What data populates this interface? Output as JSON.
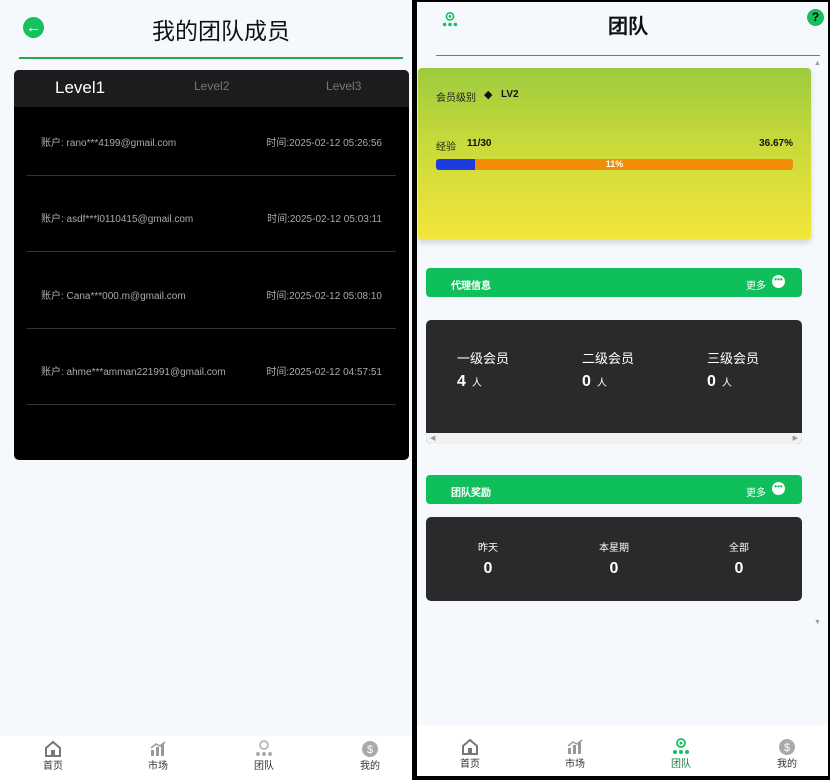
{
  "left": {
    "title": "我的团队成员",
    "tabs": [
      "Level1",
      "Level2",
      "Level3"
    ],
    "members": [
      {
        "account": "账户: rano***4199@gmail.com",
        "time": "时间:2025-02-12 05:26:56"
      },
      {
        "account": "账户: asdf***l0110415@gmail.com",
        "time": "时间:2025-02-12 05:03:11"
      },
      {
        "account": "账户: Cana***000.m@gmail.com",
        "time": "时间:2025-02-12 05:08:10"
      },
      {
        "account": "账户: ahme***amman221991@gmail.com",
        "time": "时间:2025-02-12 04:57:51"
      }
    ]
  },
  "right": {
    "title": "团队",
    "member_level_label": "会员级别",
    "member_level_value": "LV2",
    "exp_label": "经验",
    "exp_value": "11/30",
    "exp_percent": "36.67%",
    "progress_text": "11%",
    "progress_fraction": 0.11,
    "agent_section": {
      "title": "代理信息",
      "more": "更多"
    },
    "agent_levels": [
      {
        "label": "一级会员",
        "count": "4",
        "unit": "人"
      },
      {
        "label": "二级会员",
        "count": "0",
        "unit": "人"
      },
      {
        "label": "三级会员",
        "count": "0",
        "unit": "人"
      }
    ],
    "reward_section": {
      "title": "团队奖励",
      "more": "更多"
    },
    "rewards": [
      {
        "label": "昨天",
        "value": "0"
      },
      {
        "label": "本星期",
        "value": "0"
      },
      {
        "label": "全部",
        "value": "0"
      }
    ]
  },
  "tabbar": [
    {
      "label": "首页",
      "icon": "home-icon"
    },
    {
      "label": "市场",
      "icon": "market-icon"
    },
    {
      "label": "团队",
      "icon": "team-icon"
    },
    {
      "label": "我的",
      "icon": "profile-icon"
    }
  ],
  "colors": {
    "accent": "#15c15d",
    "progress_bg": "#f08c06",
    "progress_fill": "#1d3ce0",
    "card_dark": "#2a2a2c"
  }
}
